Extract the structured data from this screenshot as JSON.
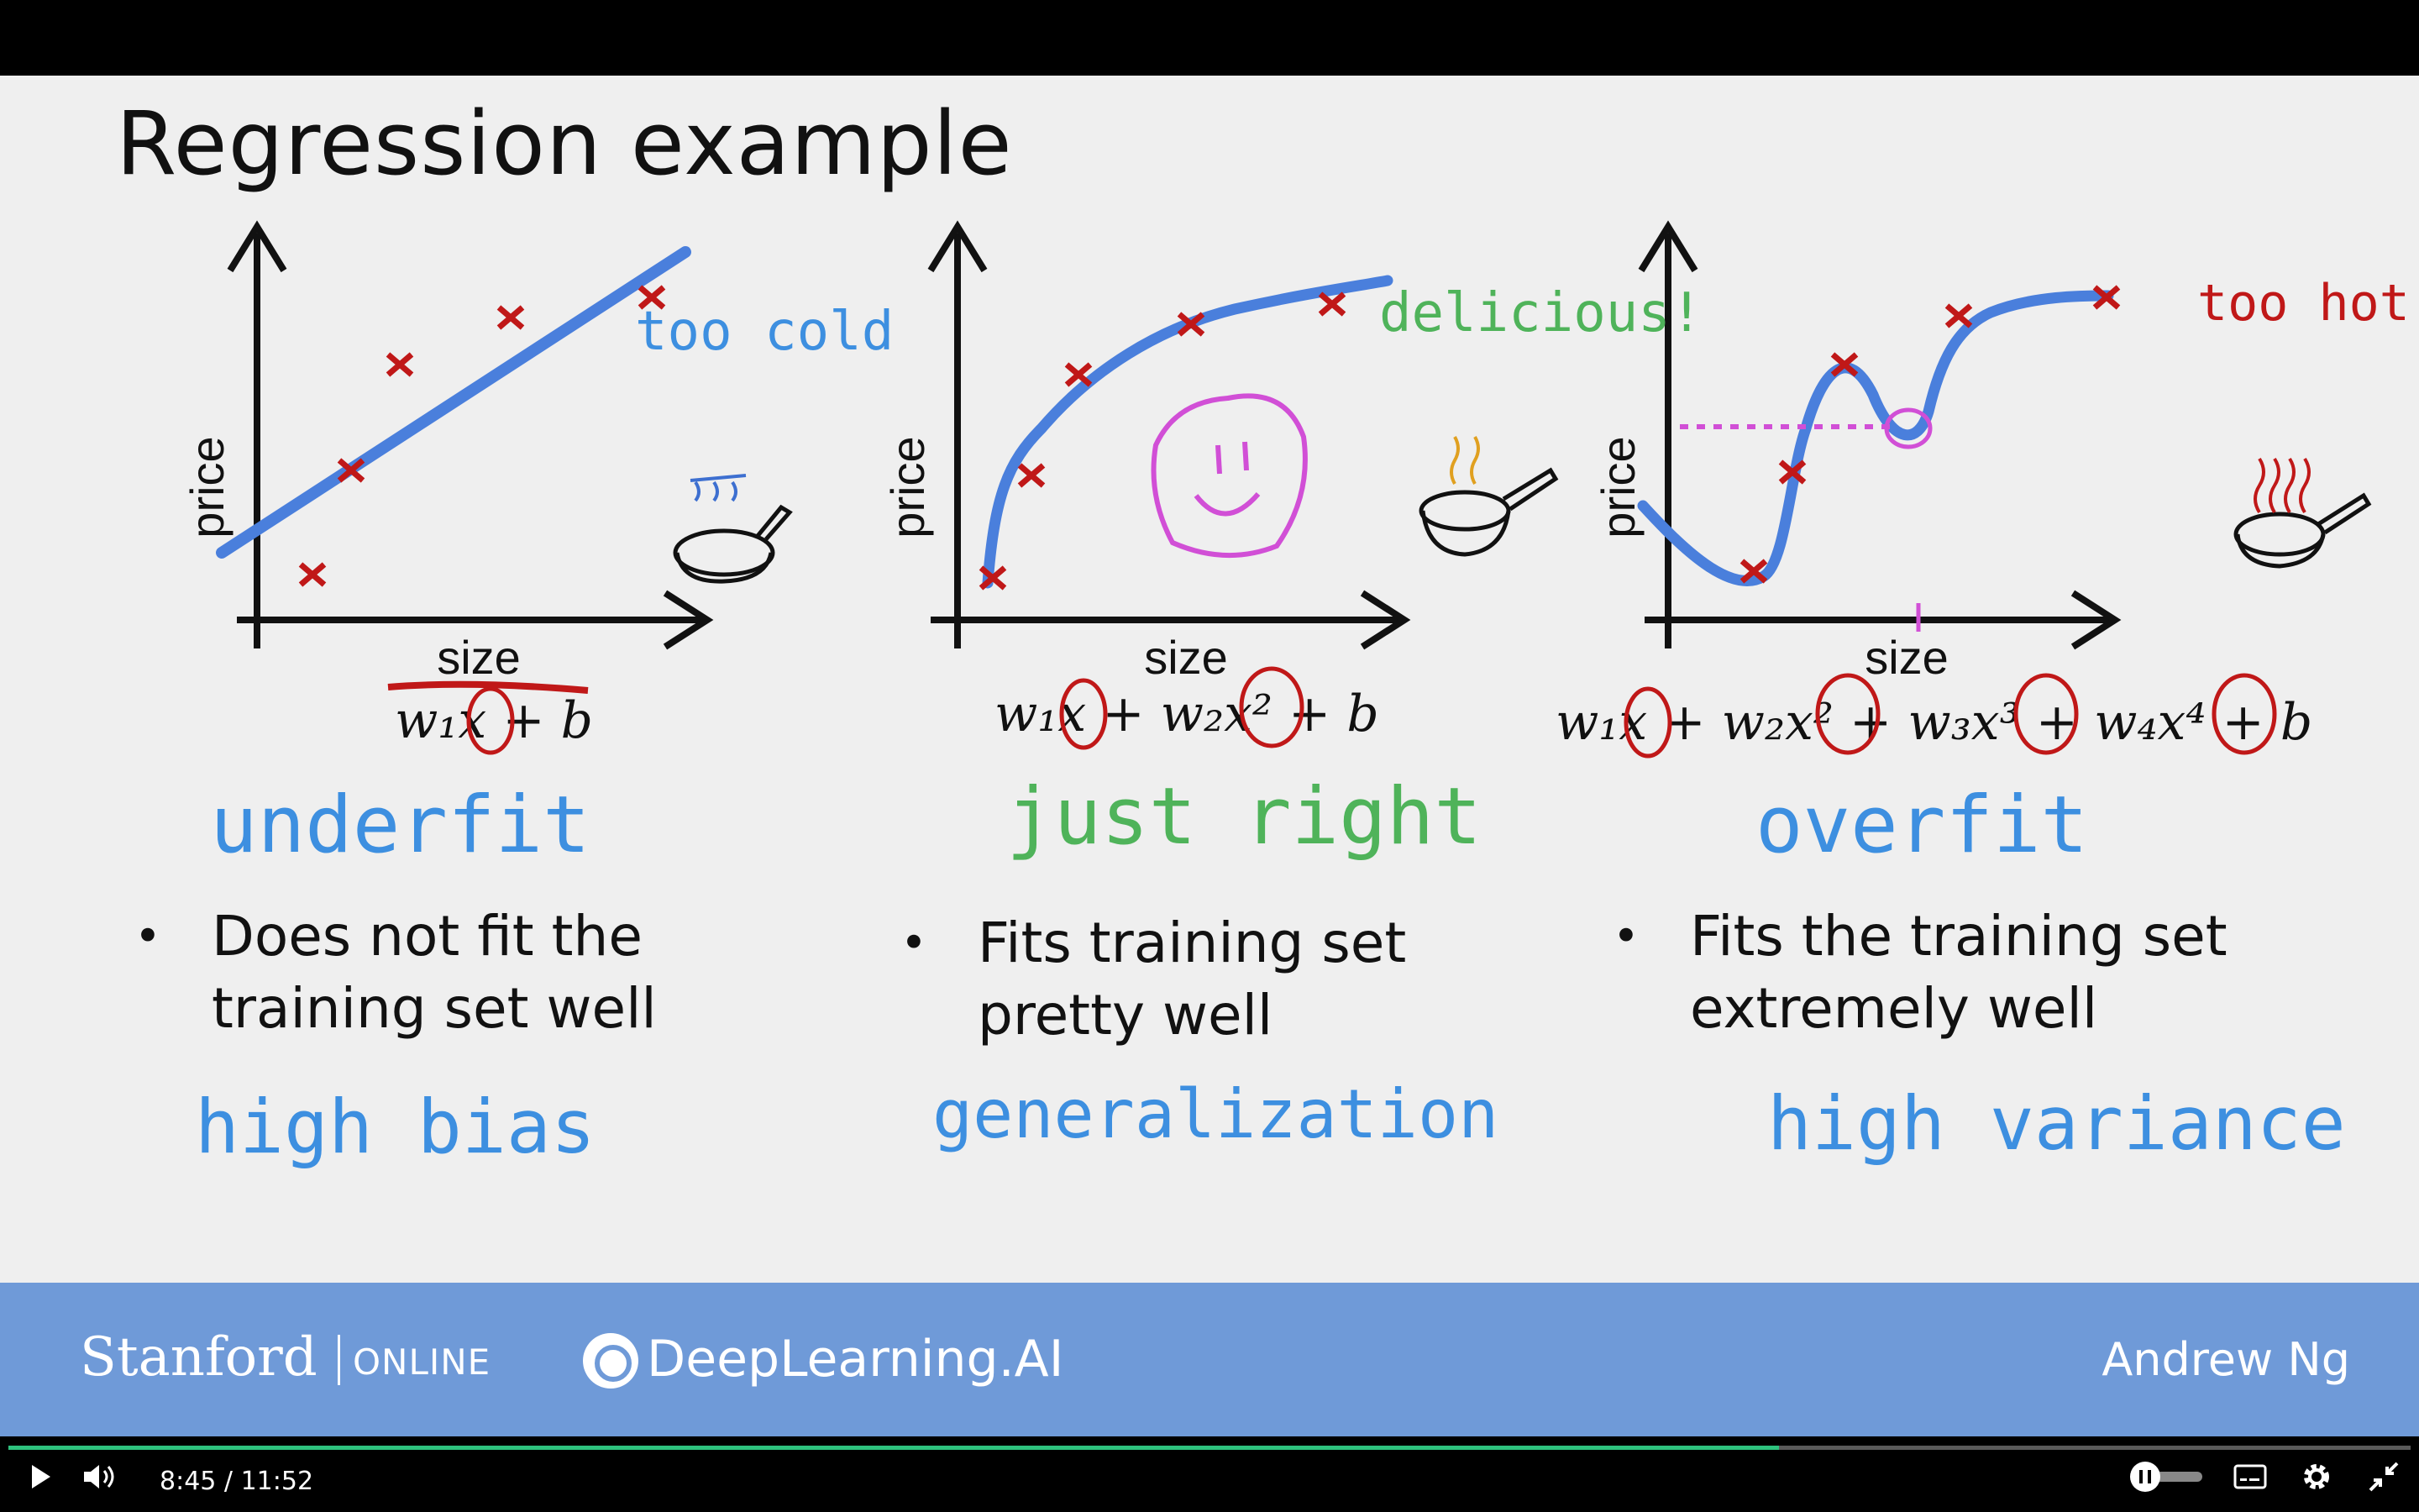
{
  "slide": {
    "title": "Regression example",
    "panels": [
      {
        "ylabel": "price",
        "xlabel": "size",
        "equation": "w₁x + b",
        "note": "too cold",
        "fit_label": "underfit",
        "bullet_lines": [
          "Does not fit the",
          "training set well"
        ],
        "footer_label": "high bias"
      },
      {
        "ylabel": "price",
        "xlabel": "size",
        "equation": "w₁x + w₂x² + b",
        "note": "delicious!",
        "fit_label": "just right",
        "bullet_lines": [
          "Fits training set",
          "pretty well"
        ],
        "footer_label": "generalization"
      },
      {
        "ylabel": "price",
        "xlabel": "size",
        "equation": "w₁x + w₂x² + w₃x³ + w₄x⁴ + b",
        "note": "too hot!",
        "fit_label": "overfit",
        "bullet_lines": [
          "Fits the training set",
          "extremely well"
        ],
        "footer_label": "high variance"
      }
    ],
    "bullet_symbol": "•"
  },
  "footer": {
    "stanford": "Stanford",
    "online": "ONLINE",
    "deeplearning": "DeepLearning.AI",
    "author": "Andrew Ng"
  },
  "player": {
    "current_time": "8:45",
    "separator": "/",
    "duration": "11:52",
    "progress_fraction": 0.737,
    "colors": {
      "progress": "#2ec27e",
      "footer": "#6f9ad8",
      "blue_ink": "#3d8fe0",
      "red_ink": "#c01818",
      "green_ink": "#4fb35a",
      "magenta_ink": "#d14fd6"
    },
    "icons": [
      "play-icon",
      "volume-icon",
      "pause-toggle-icon",
      "captions-icon",
      "gear-icon",
      "exit-fullscreen-icon"
    ]
  }
}
